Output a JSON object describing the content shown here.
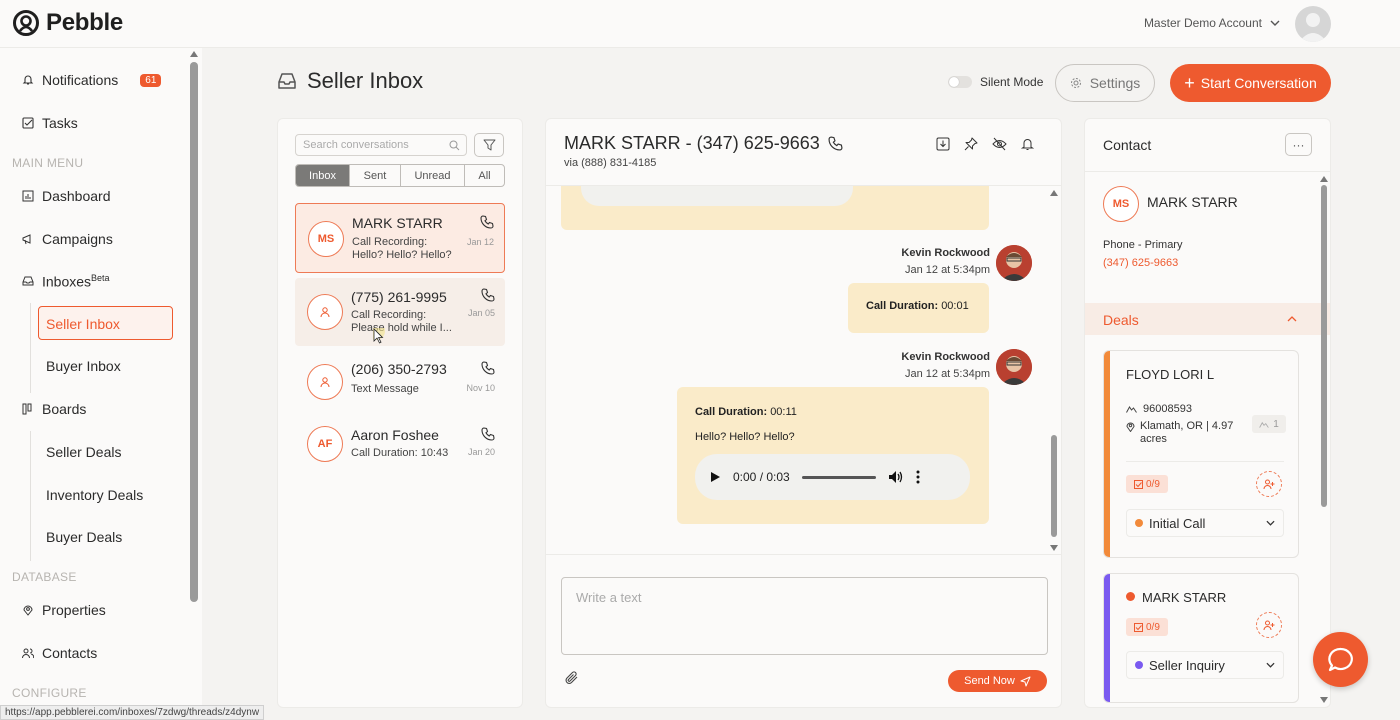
{
  "app": {
    "name": "Pebble",
    "account": "Master Demo Account"
  },
  "status_url": "https://app.pebblerei.com/inboxes/7zdwg/threads/z4dynw",
  "sidebar": {
    "notifications": {
      "label": "Notifications",
      "count": "61"
    },
    "tasks": "Tasks",
    "main_menu_label": "MAIN MENU",
    "dashboard": "Dashboard",
    "campaigns": "Campaigns",
    "inboxes": "Inboxes",
    "inboxes_badge": "Beta",
    "seller_inbox": "Seller Inbox",
    "buyer_inbox": "Buyer Inbox",
    "boards": "Boards",
    "seller_deals": "Seller Deals",
    "inventory_deals": "Inventory Deals",
    "buyer_deals": "Buyer Deals",
    "database_label": "DATABASE",
    "properties": "Properties",
    "contacts": "Contacts",
    "configure_label": "CONFIGURE"
  },
  "header": {
    "title": "Seller Inbox",
    "silent_mode": "Silent Mode",
    "settings": "Settings",
    "start_conversation": "Start Conversation"
  },
  "list": {
    "search_placeholder": "Search conversations",
    "tabs": [
      "Inbox",
      "Sent",
      "Unread",
      "All"
    ],
    "conversations": [
      {
        "initials": "MS",
        "name": "MARK STARR",
        "line1": "Call Recording:",
        "line2": "Hello? Hello? Hello?",
        "date": "Jan 12"
      },
      {
        "initials": "",
        "name": "(775) 261-9995",
        "line1": "Call Recording:",
        "line2": "Please hold while I...",
        "date": "Jan 05"
      },
      {
        "initials": "",
        "name": "(206) 350-2793",
        "line1": "Text Message",
        "line2": "",
        "date": "Nov 10"
      },
      {
        "initials": "AF",
        "name": "Aaron Foshee",
        "line1": "Call Duration: 10:43",
        "line2": "",
        "date": "Jan 20"
      }
    ]
  },
  "chat": {
    "title": "MARK STARR - (347) 625-9663",
    "via": "via (888) 831-4185",
    "messages": [
      {
        "sender": "Kevin Rockwood",
        "time": "Jan 12 at 5:34pm",
        "duration_label": "Call Duration:",
        "duration": "00:01"
      },
      {
        "sender": "Kevin Rockwood",
        "time": "Jan 12 at 5:34pm",
        "duration_label": "Call Duration:",
        "duration": "00:11",
        "text": "Hello? Hello? Hello?",
        "audio_time": "0:00 / 0:03"
      }
    ],
    "compose_placeholder": "Write a text",
    "send": "Send Now"
  },
  "contact": {
    "title": "Contact",
    "initials": "MS",
    "name": "MARK STARR",
    "phone_label": "Phone - Primary",
    "phone": "(347) 625-9663",
    "deals_label": "Deals",
    "deals": [
      {
        "title": "FLOYD LORI L",
        "parcel": "96008593",
        "location": "Klamath, OR | 4.97 acres",
        "count": "1",
        "tasks": "0/9",
        "stage": "Initial Call",
        "color": "#f28a3a"
      },
      {
        "title": "MARK STARR",
        "tasks": "0/9",
        "stage": "Seller Inquiry",
        "color": "#7a5af0"
      }
    ]
  },
  "colors": {
    "accent": "#ee5a2f"
  }
}
